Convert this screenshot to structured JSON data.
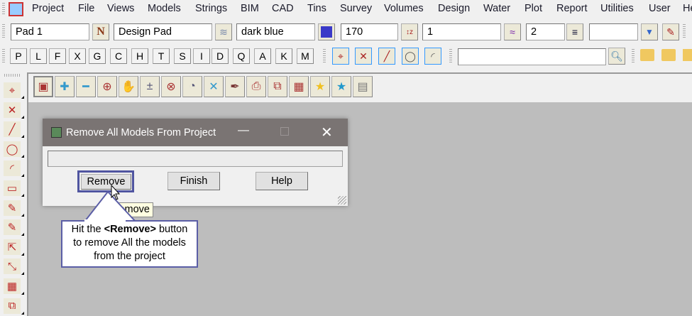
{
  "menu": {
    "items": [
      "Project",
      "File",
      "Views",
      "Models",
      "Strings",
      "BIM",
      "CAD",
      "Tins",
      "Survey",
      "Volumes",
      "Design",
      "Water",
      "Plot",
      "Report",
      "Utilities",
      "User",
      "He"
    ]
  },
  "toolbar": {
    "name_value": "Pad 1",
    "model_value": "Design Pad",
    "colour_value": "dark blue",
    "colour_swatch": "#3a3ac8",
    "height_value": "170",
    "style_value": "1",
    "weight_value": "2",
    "extra_value": "",
    "search_value": ""
  },
  "letters": [
    "P",
    "L",
    "F",
    "X",
    "G",
    "C",
    "H",
    "T",
    "S",
    "I",
    "D",
    "Q",
    "A",
    "K",
    "M"
  ],
  "dialog": {
    "title": "Remove All Models From Project",
    "progress_text": "",
    "remove_label": "Remove",
    "finish_label": "Finish",
    "help_label": "Help"
  },
  "tooltip": {
    "text": "Remove"
  },
  "callout": {
    "line1_pre": "Hit the ",
    "line1_bold": "<Remove>",
    "line1_post": " button",
    "line2": "to remove All the models",
    "line3": "from the project"
  }
}
